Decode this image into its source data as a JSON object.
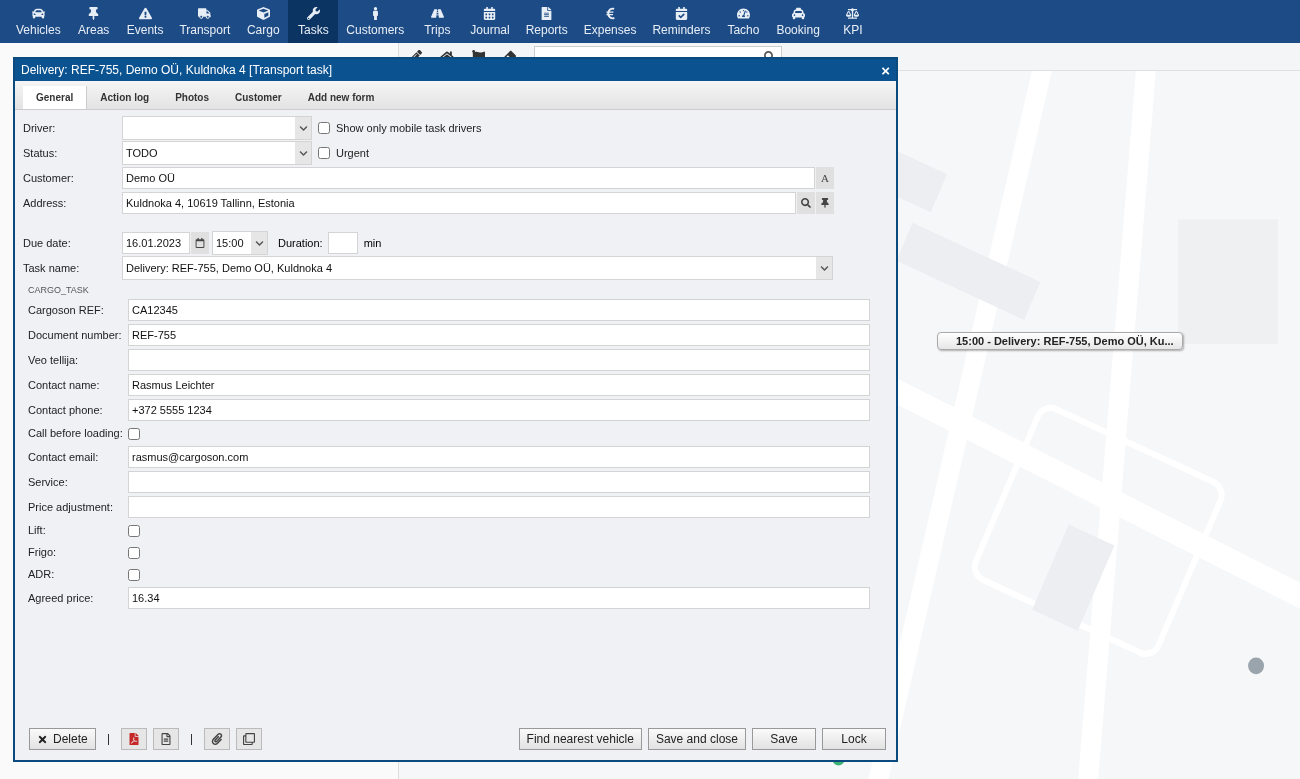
{
  "nav": [
    {
      "label": "Vehicles",
      "selected": false
    },
    {
      "label": "Areas",
      "selected": false
    },
    {
      "label": "Events",
      "selected": false
    },
    {
      "label": "Transport",
      "selected": false
    },
    {
      "label": "Cargo",
      "selected": false
    },
    {
      "label": "Tasks",
      "selected": true
    },
    {
      "label": "Customers",
      "selected": false
    },
    {
      "label": "Trips",
      "selected": false
    },
    {
      "label": "Journal",
      "selected": false
    },
    {
      "label": "Reports",
      "selected": false
    },
    {
      "label": "Expenses",
      "selected": false
    },
    {
      "label": "Reminders",
      "selected": false
    },
    {
      "label": "Tacho",
      "selected": false
    },
    {
      "label": "Booking",
      "selected": false
    },
    {
      "label": "KPI",
      "selected": false
    }
  ],
  "map": {
    "marker_label": "15:00 - Delivery: REF-755, Demo OÜ, Ku..."
  },
  "dialog": {
    "title": "Delivery: REF-755, Demo OÜ, Kuldnoka 4 [Transport task]",
    "close": "×",
    "tabs": [
      {
        "label": "General",
        "selected": true
      },
      {
        "label": "Action log",
        "selected": false
      },
      {
        "label": "Photos",
        "selected": false
      },
      {
        "label": "Customer",
        "selected": false
      },
      {
        "label": "Add new form",
        "selected": false
      }
    ],
    "driver": {
      "label": "Driver:",
      "option": {
        "label": "Show only mobile task drivers",
        "checked": false
      }
    },
    "status": {
      "label": "Status:",
      "value": "TODO",
      "option": {
        "label": "Urgent",
        "checked": false
      }
    },
    "customer": {
      "label": "Customer:",
      "value": "Demo OÜ",
      "button": "A"
    },
    "address": {
      "label": "Address:",
      "value": "Kuldnoka 4, 10619 Tallinn, Estonia"
    },
    "due_date": {
      "label": "Due date:",
      "date": "16.01.2023",
      "time": "15:00",
      "duration_label": "Duration:",
      "unit": "min"
    },
    "task_name": {
      "label": "Task name:",
      "value": "Delivery: REF-755, Demo OÜ, Kuldnoka 4"
    },
    "section": "CARGO_TASK",
    "fields": [
      {
        "kind": "text",
        "label": "Cargoson REF:",
        "value": "CA12345"
      },
      {
        "kind": "text",
        "label": "Document number:",
        "value": "REF-755"
      },
      {
        "kind": "text",
        "label": "Veo tellija:"
      },
      {
        "kind": "text",
        "label": "Contact name:",
        "value": "Rasmus Leichter"
      },
      {
        "kind": "text",
        "label": "Contact phone:",
        "value": "+372 5555 1234"
      },
      {
        "kind": "checkbox",
        "label": "Call before loading:",
        "checked": false
      },
      {
        "kind": "text",
        "label": "Contact email:",
        "value": "rasmus@cargoson.com"
      },
      {
        "kind": "text",
        "label": "Service:"
      },
      {
        "kind": "text",
        "label": "Price adjustment:"
      },
      {
        "kind": "checkbox",
        "label": "Lift:",
        "checked": false
      },
      {
        "kind": "checkbox",
        "label": "Frigo:",
        "checked": false
      },
      {
        "kind": "checkbox",
        "label": "ADR:",
        "checked": false
      },
      {
        "kind": "text",
        "label": "Agreed price:",
        "value": "16.34"
      }
    ],
    "footer": {
      "delete": "Delete",
      "actions": [
        "Find nearest vehicle",
        "Save and close",
        "Save",
        "Lock"
      ]
    }
  }
}
